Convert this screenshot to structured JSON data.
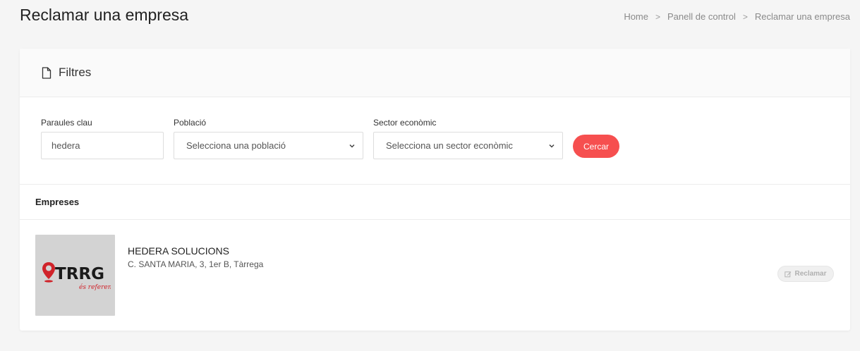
{
  "page": {
    "title": "Reclamar una empresa"
  },
  "breadcrumb": {
    "items": [
      "Home",
      "Panell de control",
      "Reclamar una empresa"
    ],
    "separator": ">"
  },
  "filters": {
    "title": "Filtres",
    "icon": "document-icon",
    "keywords": {
      "label": "Paraules clau",
      "value": "hedera"
    },
    "population": {
      "label": "Població",
      "selected": "Selecciona una població"
    },
    "sector": {
      "label": "Sector econòmic",
      "selected": "Selecciona un sector econòmic"
    },
    "search_label": "Cercar"
  },
  "results": {
    "title": "Empreses",
    "companies": [
      {
        "name": "HEDERA SOLUCIONS",
        "address": "C. SANTA MARIA, 3, 1er B, Tàrrega",
        "logo_text": "TRRG",
        "logo_tagline": "és referent",
        "claim_label": "Reclamar"
      }
    ]
  },
  "colors": {
    "accent": "#f64f4f",
    "background": "#f5f5f5",
    "logo_red": "#d0232a"
  }
}
